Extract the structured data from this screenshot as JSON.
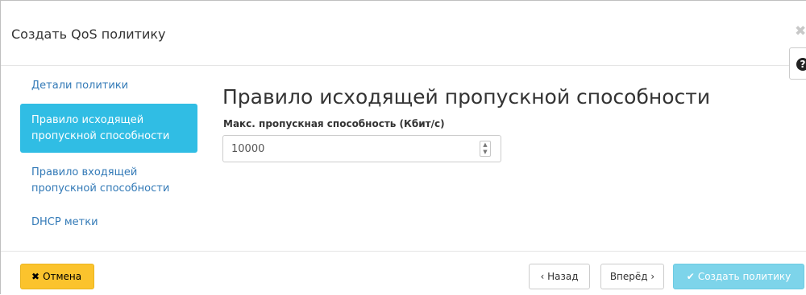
{
  "dialog": {
    "title": "Создать QoS политику",
    "close_icon": "close-icon",
    "help_icon": "question-circle-icon"
  },
  "nav": {
    "items": [
      {
        "label": "Детали политики",
        "active": false
      },
      {
        "label_line1": "Правило исходящей",
        "label_line2": "пропускной способности",
        "active": true
      },
      {
        "label_line1": "Правило входящей",
        "label_line2": "пропускной способности",
        "active": false
      },
      {
        "label": "DHCP метки",
        "active": false
      }
    ]
  },
  "main": {
    "title": "Правило исходящей пропускной способности",
    "field_label": "Макс. пропускная способность (Кбит/с)",
    "field_value": "10000"
  },
  "footer": {
    "cancel_label": "Отмена",
    "back_label": "‹ Назад",
    "next_label": "Вперёд ›",
    "create_label": "Создать политику"
  },
  "colors": {
    "active_nav": "#30bde4",
    "cancel_button": "#fbc32d",
    "create_button": "#7dd4ea",
    "link": "#337ab7"
  }
}
